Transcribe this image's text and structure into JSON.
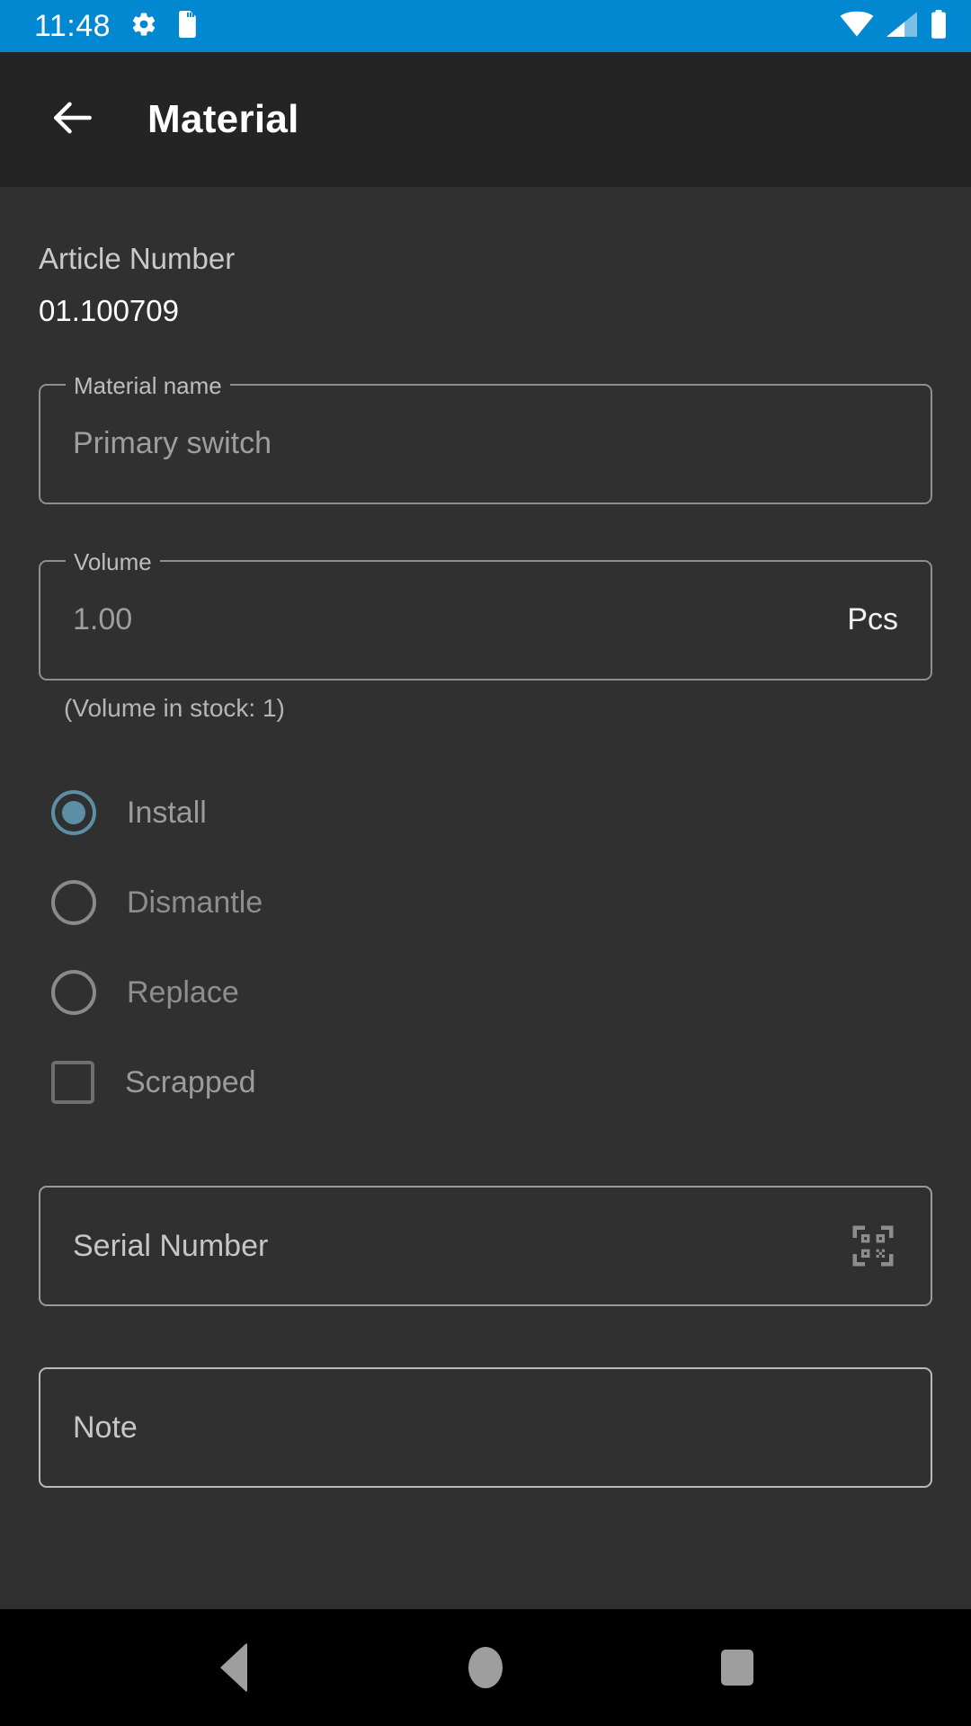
{
  "status_bar": {
    "clock": "11:48",
    "icons": [
      "gear-icon",
      "sd-card-icon"
    ],
    "right_icons": [
      "wifi-icon",
      "cellular-signal-icon",
      "battery-icon"
    ],
    "background_color": "#0288d1"
  },
  "app_bar": {
    "back_icon": "arrow-left-icon",
    "title": "Material",
    "background_color": "#242424"
  },
  "form": {
    "article_number": {
      "label": "Article Number",
      "value": "01.100709"
    },
    "material_name": {
      "label": "Material name",
      "value": "Primary switch"
    },
    "volume": {
      "label": "Volume",
      "value": "1.00",
      "unit": "Pcs",
      "helper": "(Volume in stock: 1)"
    },
    "action_options": [
      {
        "label": "Install",
        "type": "radio",
        "selected": true
      },
      {
        "label": "Dismantle",
        "type": "radio",
        "selected": false
      },
      {
        "label": "Replace",
        "type": "radio",
        "selected": false
      },
      {
        "label": "Scrapped",
        "type": "checkbox",
        "checked": false
      }
    ],
    "serial_number": {
      "placeholder": "Serial Number",
      "scan_icon": "qr-code-scan-icon"
    },
    "note": {
      "placeholder": "Note"
    }
  },
  "nav_bar": {
    "back": "nav-back-triangle-icon",
    "home": "nav-home-circle-icon",
    "recents": "nav-recents-square-icon"
  },
  "colors": {
    "accent": "#0288d1",
    "radio_selected": "#5c8fa6",
    "surface": "#303030",
    "app_bar": "#242424"
  }
}
